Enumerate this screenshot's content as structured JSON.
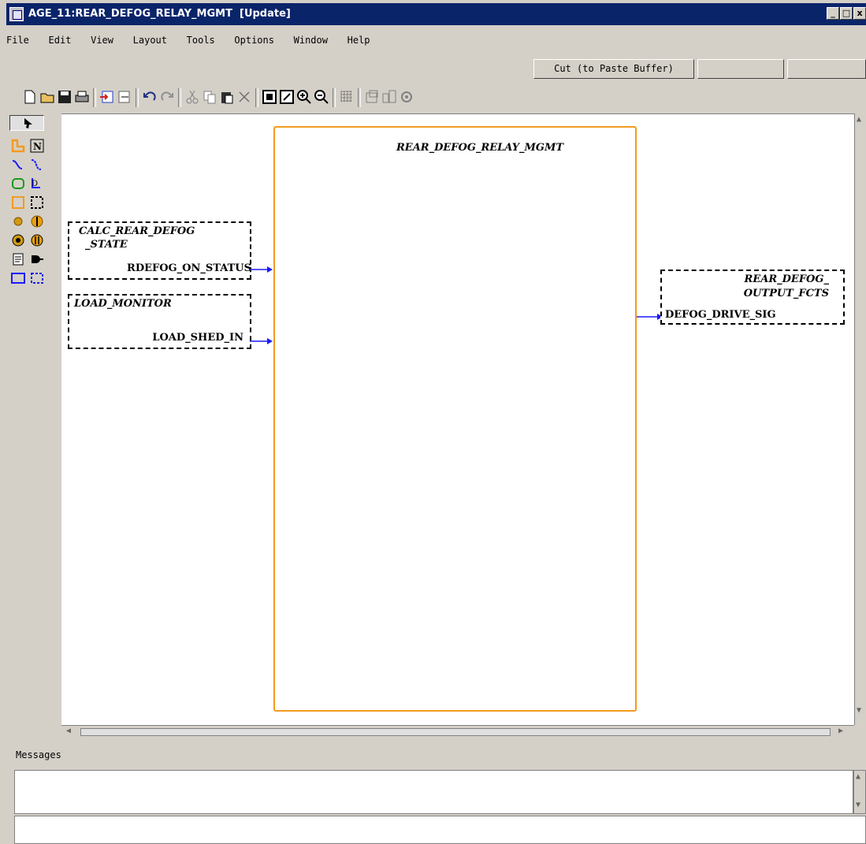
{
  "window": {
    "title": "AGE_11:REAR_DEFOG_RELAY_MGMT  [Update]",
    "controls": [
      "_",
      "□",
      "x"
    ]
  },
  "menu": {
    "items": [
      {
        "label": "File"
      },
      {
        "label": "Edit"
      },
      {
        "label": "View"
      },
      {
        "label": "Layout"
      },
      {
        "label": "Tools"
      },
      {
        "label": "Options"
      },
      {
        "label": "Window"
      },
      {
        "label": "Help"
      }
    ]
  },
  "actionbar": {
    "cut_label": "Cut (to Paste Buffer)"
  },
  "toolbar": {
    "icons": [
      "new-icon",
      "open-icon",
      "save-icon",
      "print-icon",
      "import-icon",
      "export-icon",
      "undo-icon",
      "redo-icon",
      "cut-icon",
      "copy-icon",
      "paste-icon",
      "delete-icon",
      "fit-icon",
      "zoom-area-icon",
      "zoom-in-icon",
      "zoom-out-icon",
      "grid-icon",
      "properties-icon",
      "hierarchy-icon",
      "settings-icon"
    ]
  },
  "palette": {
    "tools": [
      "select-tool",
      "block-tool",
      "note-tool",
      "connector-tool",
      "curved-connector-tool",
      "state-tool",
      "transition-tool",
      "box-tool",
      "dashed-box-tool",
      "junction-tool",
      "history-tool",
      "deep-history-tool",
      "terminal-tool",
      "code-tool",
      "gate-tool",
      "frame-tool",
      "dashed-frame-tool"
    ],
    "accent": "#f39a20"
  },
  "diagram": {
    "main_block": {
      "label": "REAR_DEFOG_RELAY_MGMT",
      "color": "#f39a20"
    },
    "inputs": [
      {
        "title_line1": "CALC_REAR_DEFOG",
        "title_line2": "_STATE",
        "port": "RDEFOG_ON_STATUS"
      },
      {
        "title_line1": "LOAD_MONITOR",
        "port": "LOAD_SHED_IN"
      }
    ],
    "outputs": [
      {
        "title_line1": "REAR_DEFOG_",
        "title_line2": "OUTPUT_FCTS",
        "port": "DEFOG_DRIVE_SIG"
      }
    ],
    "arrow_color": "#1a1aff"
  },
  "messages": {
    "label": "Messages",
    "text": "",
    "command": ""
  }
}
